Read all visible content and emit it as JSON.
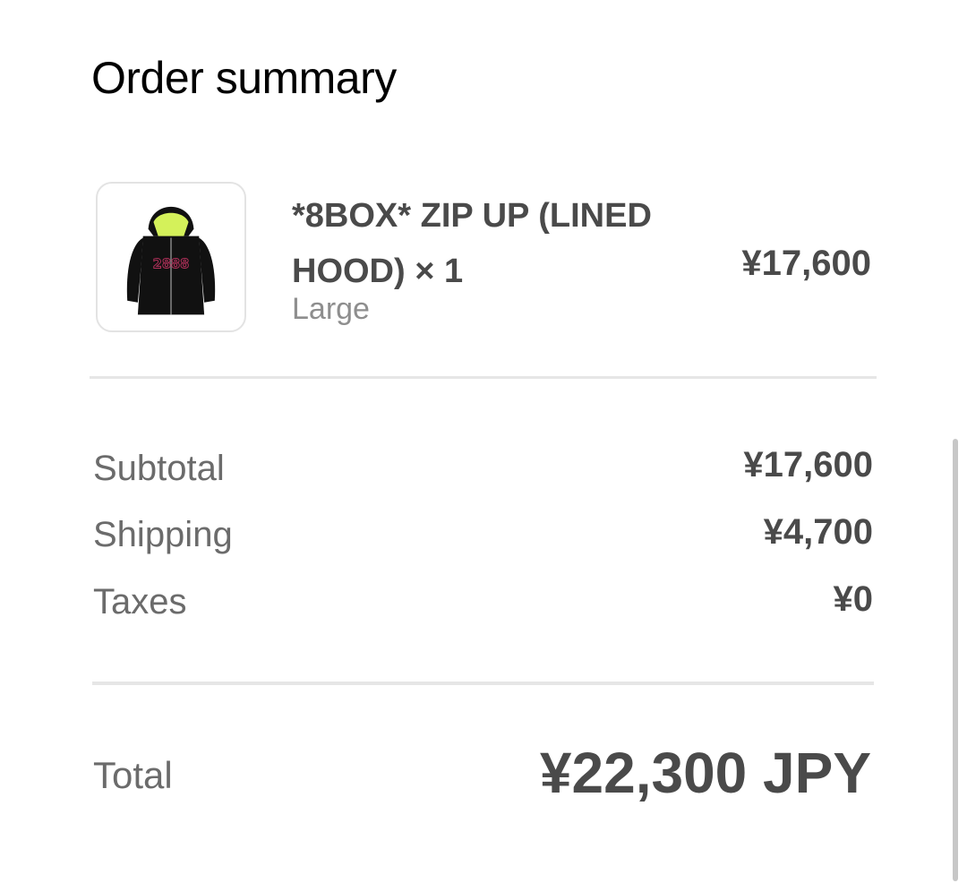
{
  "title": "Order summary",
  "item": {
    "name": "*8BOX* ZIP UP (LINED HOOD)",
    "quantity_label": "× 1",
    "variant": "Large",
    "price": "¥17,600",
    "image_icon": "black-zip-hoodie-image",
    "print_text": "2888"
  },
  "totals": {
    "subtotal_label": "Subtotal",
    "subtotal_value": "¥17,600",
    "shipping_label": "Shipping",
    "shipping_value": "¥4,700",
    "taxes_label": "Taxes",
    "taxes_value": "¥0",
    "total_label": "Total",
    "total_value": "¥22,300 JPY"
  },
  "colors": {
    "hoodie": "#111111",
    "lining": "#d4f15a",
    "print": "#b0305a"
  }
}
